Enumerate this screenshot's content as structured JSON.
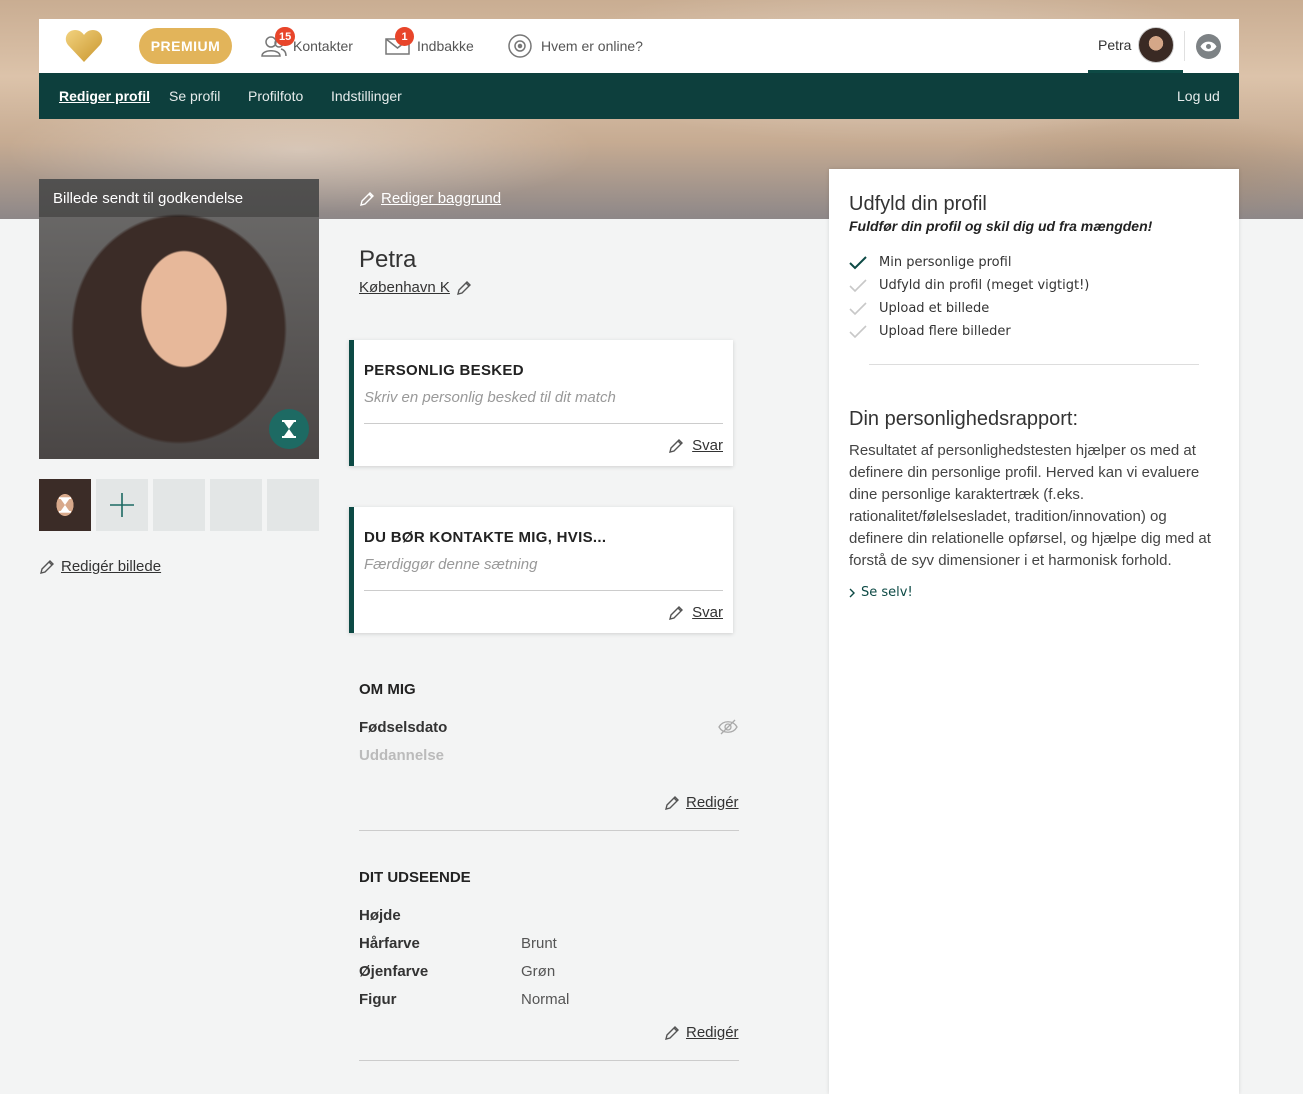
{
  "header": {
    "premium_label": "PREMIUM",
    "contacts": {
      "label": "Kontakter",
      "count": "15"
    },
    "inbox": {
      "label": "Indbakke",
      "count": "1"
    },
    "online": {
      "label": "Hvem er online?"
    },
    "user_name": "Petra"
  },
  "subnav": {
    "items": [
      "Rediger profil",
      "Se profil",
      "Profilfoto",
      "Indstillinger"
    ],
    "logout": "Log ud"
  },
  "photo": {
    "caption": "Billede sendt til godkendelse",
    "edit_label": "Redigér billede"
  },
  "profile": {
    "edit_background": "Rediger baggrund",
    "name": "Petra",
    "city": "København K"
  },
  "cards": [
    {
      "title": "PERSONLIG BESKED",
      "placeholder": "Skriv en personlig besked til dit match",
      "reply": "Svar"
    },
    {
      "title": "DU BØR KONTAKTE MIG, HVIS...",
      "placeholder": "Færdiggør denne sætning",
      "reply": "Svar"
    }
  ],
  "about": {
    "title": "OM MIG",
    "fields": [
      "Fødselsdato",
      "Uddannelse"
    ],
    "edit": "Redigér"
  },
  "appearance": {
    "title": "DIT UDSEENDE",
    "rows": [
      {
        "label": "Højde",
        "value": ""
      },
      {
        "label": "Hårfarve",
        "value": "Brunt"
      },
      {
        "label": "Øjenfarve",
        "value": "Grøn"
      },
      {
        "label": "Figur",
        "value": "Normal"
      }
    ],
    "edit": "Redigér"
  },
  "sidebar": {
    "title": "Udfyld din profil",
    "subtitle": "Fuldfør din profil og skil dig ud fra mængden!",
    "checklist": [
      {
        "label": "Min personlige profil",
        "done": true
      },
      {
        "label": "Udfyld din profil (meget vigtigt!)",
        "done": false
      },
      {
        "label": "Upload et billede",
        "done": false
      },
      {
        "label": "Upload flere billeder",
        "done": false
      }
    ],
    "report_title": "Din personlighedsrapport:",
    "report_text": "Resultatet af personlighedstesten hjælper os med at definere din personlige profil. Herved kan vi evaluere dine personlige karaktertræk (f.eks. rationalitet/følelsesladet, tradition/innovation) og definere din relationelle opførsel, og hjælpe dig med at forstå de syv dimensioner i et harmonisk forhold.",
    "cta": "Se selv!"
  },
  "colors": {
    "brand": "#0d3f3d",
    "premium": "#e2b45a",
    "badge": "#e8452a"
  }
}
